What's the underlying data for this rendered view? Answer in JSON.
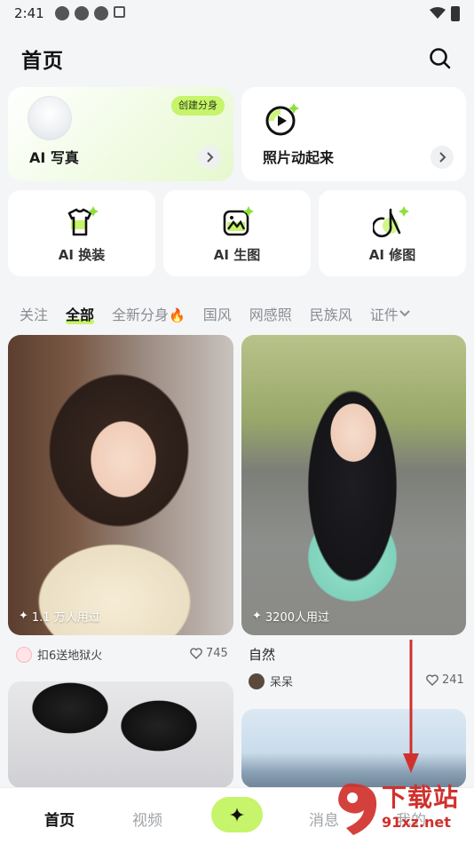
{
  "status_bar": {
    "time": "2:41"
  },
  "header": {
    "title": "首页"
  },
  "top_cards": [
    {
      "label": "AI 写真",
      "badge": "创建分身"
    },
    {
      "label": "照片动起来"
    }
  ],
  "feature_cards": [
    {
      "label": "AI 换装",
      "icon": "outfit-icon"
    },
    {
      "label": "AI 生图",
      "icon": "image-gen-icon"
    },
    {
      "label": "AI 修图",
      "icon": "retouch-icon"
    }
  ],
  "tabs": [
    {
      "label": "关注"
    },
    {
      "label": "全部",
      "active": true
    },
    {
      "label": "全新分身"
    },
    {
      "label": "国风"
    },
    {
      "label": "网感照"
    },
    {
      "label": "民族风"
    },
    {
      "label": "证件"
    }
  ],
  "feed": [
    {
      "usage": "1.1 万人用过",
      "author": "扣6送地狱火",
      "likes": "745"
    },
    {
      "usage": "3200人用过",
      "title": "自然",
      "author": "呆呆",
      "likes": "241"
    }
  ],
  "bottom_nav": {
    "home": "首页",
    "video": "视频",
    "messages": "消息",
    "mine": "我的"
  },
  "watermark": {
    "top": "下载站",
    "bottom": "91xz.net"
  },
  "colors": {
    "accent": "#c6f46a",
    "arrow": "#d0312d"
  }
}
